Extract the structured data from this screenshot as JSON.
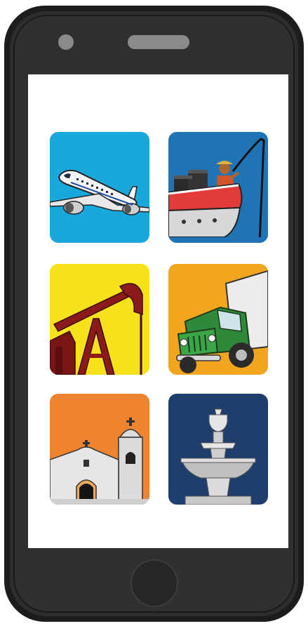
{
  "phone": {
    "body_color": "#2b2b2b",
    "screen_color": "#ffffff"
  },
  "tiles": [
    {
      "icon": "airplane-icon",
      "bg": "#19a8dc"
    },
    {
      "icon": "fishing-boat-icon",
      "bg": "#1f74b5"
    },
    {
      "icon": "oil-pump-jack-icon",
      "bg": "#f7e11a"
    },
    {
      "icon": "delivery-truck-icon",
      "bg": "#f2a61f"
    },
    {
      "icon": "mission-church-icon",
      "bg": "#ee8430"
    },
    {
      "icon": "fountain-icon",
      "bg": "#1e3f6d"
    }
  ]
}
